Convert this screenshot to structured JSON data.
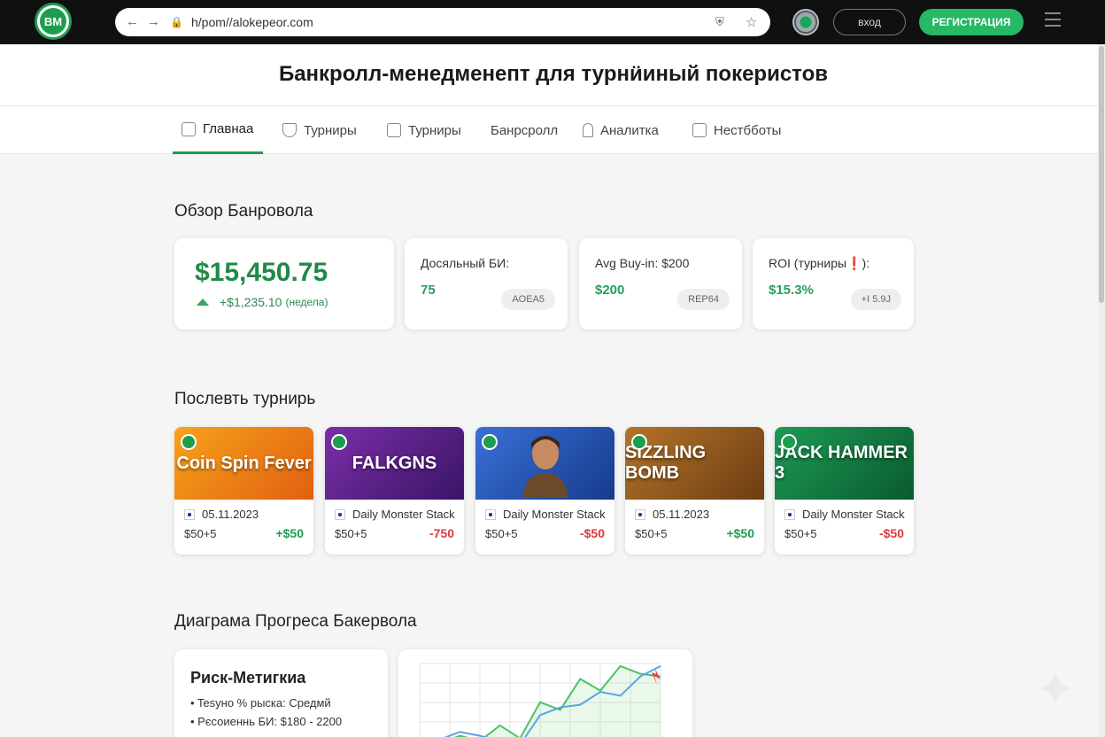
{
  "browser": {
    "logo_text": "BM",
    "url": "h/pom//alokepeor.com",
    "login_label": "вход",
    "register_label": "РЕГИСТРАЦИЯ"
  },
  "page_title": "Банкролл-менедменепт для турнӥиный покеристов",
  "tabs": [
    {
      "label": "Главнаа",
      "icon": "home-icon",
      "active": true
    },
    {
      "label": "Турниры",
      "icon": "trophy-icon",
      "active": false
    },
    {
      "label": "Турниры",
      "icon": "calendar-icon",
      "active": false
    },
    {
      "label": "Банрсролл",
      "icon": "",
      "active": false
    },
    {
      "label": "Аналитка",
      "icon": "bell-icon",
      "active": false
    },
    {
      "label": "Нестбботы",
      "icon": "list-icon",
      "active": false
    }
  ],
  "overview": {
    "heading": "Обзор Банровола",
    "balance": "$15,450.75",
    "delta": "+$1,235.10",
    "delta_period": "(недела)",
    "stats": [
      {
        "label": "Досяльный БИ:",
        "value": "75",
        "pill": "AOEA5"
      },
      {
        "label": "Avg Buy-in: $200",
        "value": "$200",
        "pill": "REP64"
      },
      {
        "label": "ROI (турниры❗):",
        "value": "$15.3%",
        "pill": "+I 5.9J"
      }
    ]
  },
  "recent": {
    "heading": "Послевть турнирь",
    "tournaments": [
      {
        "banner": "Coin Spin Fever",
        "banner_colors": [
          "#f7a21b",
          "#e06010"
        ],
        "title": "05.11.2023",
        "buyin": "$50+5",
        "result": "+$50",
        "result_color": "#1f9d4e"
      },
      {
        "banner": "FALKGNS",
        "banner_colors": [
          "#7b2fa8",
          "#3a1466"
        ],
        "title": "Daily Monster Stack",
        "buyin": "$50+5",
        "result": "-750",
        "result_color": "#d93b3b"
      },
      {
        "banner": "",
        "banner_colors": [
          "#3a70d6",
          "#153b8c"
        ],
        "title": "Daily Monster Stack",
        "buyin": "$50+5",
        "result": "-$50",
        "result_color": "#d93b3b"
      },
      {
        "banner": "SIZZLING BOMB",
        "banner_colors": [
          "#b3742b",
          "#6e3d12"
        ],
        "title": "05.11.2023",
        "buyin": "$50+5",
        "result": "+$50",
        "result_color": "#1f9d4e"
      },
      {
        "banner": "JACK HAMMER 3",
        "banner_colors": [
          "#1c9a55",
          "#0a5a2e"
        ],
        "title": "Daily Monster Stack",
        "buyin": "$50+5",
        "result": "-$50",
        "result_color": "#d93b3b"
      }
    ]
  },
  "progress": {
    "heading": "Диаграма Прогреса Бакервола",
    "risk_title": "Риск-Метигкиа",
    "risk_lines": [
      "• Tesyнo % рыска: Средмй",
      "• Рєсоиеннь БИ: $180 - 2200"
    ]
  },
  "chart_data": {
    "type": "line",
    "series": [
      {
        "values": [
          2,
          8,
          14,
          10,
          22,
          12,
          40,
          34,
          58,
          49,
          68,
          62,
          60
        ]
      },
      {
        "values": [
          5,
          11,
          17,
          14,
          10,
          7,
          30,
          36,
          38,
          48,
          45,
          60,
          68
        ]
      }
    ],
    "ylim": [
      0,
      70
    ],
    "grid": true,
    "colors": [
      "#49c45e",
      "#5aa3e8"
    ]
  }
}
